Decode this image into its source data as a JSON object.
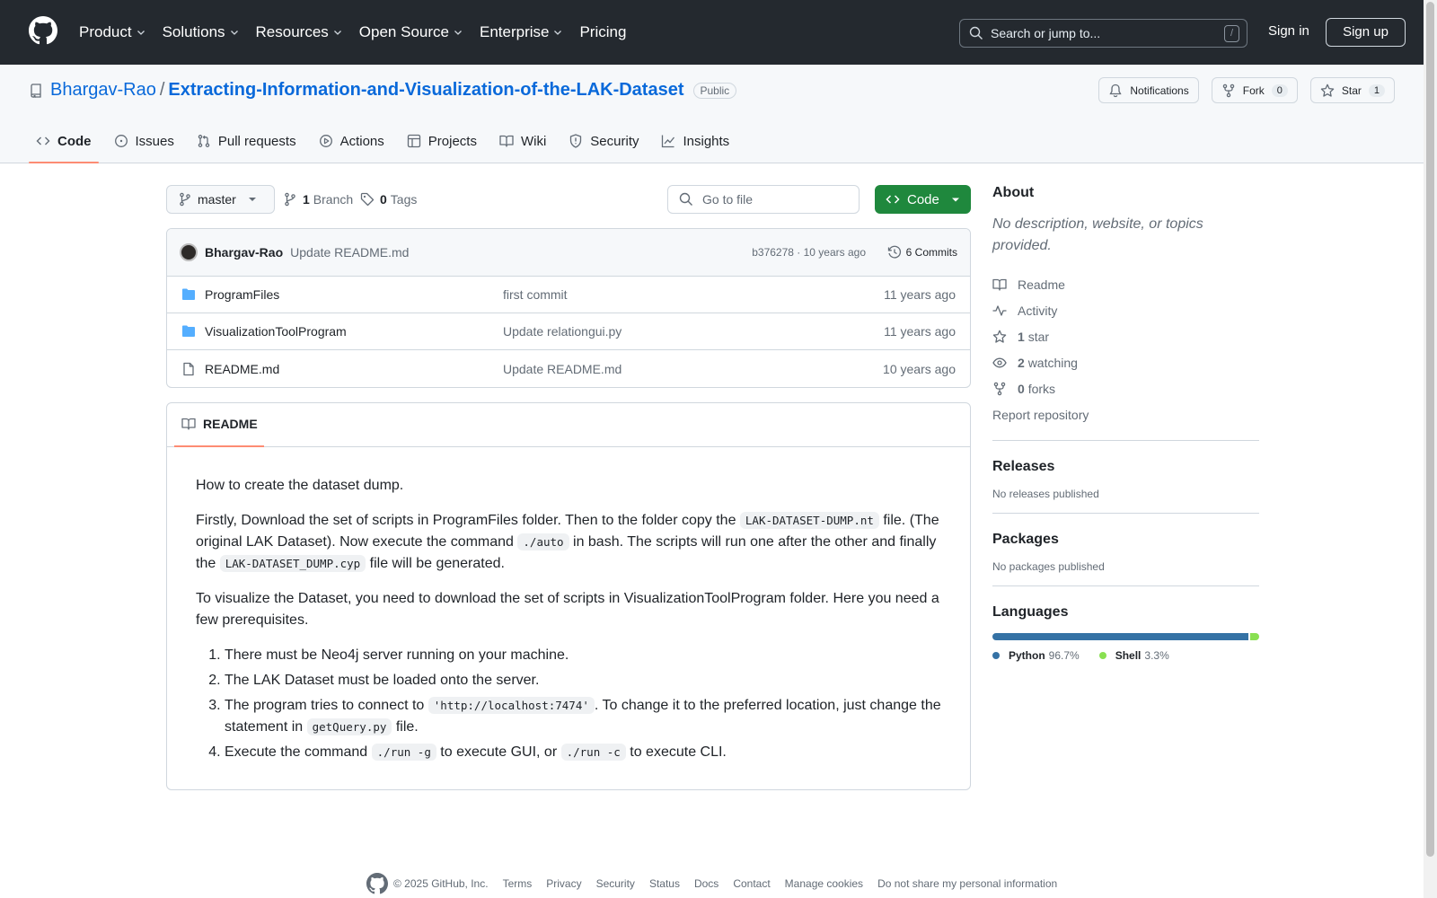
{
  "header": {
    "nav": [
      "Product",
      "Solutions",
      "Resources",
      "Open Source",
      "Enterprise",
      "Pricing"
    ],
    "search_placeholder": "Search or jump to...",
    "search_key": "/",
    "sign_in": "Sign in",
    "sign_up": "Sign up"
  },
  "repo": {
    "owner": "Bhargav-Rao",
    "separator": "/",
    "name": "Extracting-Information-and-Visualization-of-the-LAK-Dataset",
    "visibility": "Public",
    "notifications_label": "Notifications",
    "fork_label": "Fork",
    "fork_count": "0",
    "star_label": "Star",
    "star_count": "1",
    "tabs": [
      "Code",
      "Issues",
      "Pull requests",
      "Actions",
      "Projects",
      "Wiki",
      "Security",
      "Insights"
    ]
  },
  "toolbar": {
    "branch": "master",
    "branch_count": "1",
    "branch_label": "Branch",
    "tag_count": "0",
    "tag_label": "Tags",
    "go_to_file": "Go to file",
    "code_button": "Code"
  },
  "commit": {
    "author": "Bhargav-Rao",
    "message": "Update README.md",
    "hash_age": "b376278 · 10 years ago",
    "commits": "6 Commits"
  },
  "files": [
    {
      "name": "ProgramFiles",
      "type": "folder",
      "message": "first commit",
      "age": "11 years ago"
    },
    {
      "name": "VisualizationToolProgram",
      "type": "folder",
      "message": "Update relationgui.py",
      "age": "11 years ago"
    },
    {
      "name": "README.md",
      "type": "file",
      "message": "Update README.md",
      "age": "10 years ago"
    }
  ],
  "readme": {
    "tab": "README",
    "p1": "How to create the dataset dump.",
    "p2": {
      "a": "Firstly, Download the set of scripts in ProgramFiles folder. Then to the folder copy the ",
      "c1": "LAK-DATASET-DUMP.nt",
      "b": " file. (The original LAK Dataset). Now execute the command ",
      "c2": "./auto",
      "d": " in bash. The scripts will run one after the other and finally the ",
      "c3": "LAK-DATASET_DUMP.cyp",
      "e": " file will be generated."
    },
    "p3": "To visualize the Dataset, you need to download the set of scripts in VisualizationToolProgram folder. Here you need a few prerequisites.",
    "li1": "There must be Neo4j server running on your machine.",
    "li2": "The LAK Dataset must be loaded onto the server.",
    "li3": {
      "a": "The program tries to connect to ",
      "c1": "'http://localhost:7474'",
      "b": ". To change it to the preferred location, just change the statement in ",
      "c2": "getQuery.py",
      "d": " file."
    },
    "li4": {
      "a": "Execute the command ",
      "c1": "./run -g",
      "b": " to execute GUI, or ",
      "c2": "./run -c",
      "d": " to execute CLI."
    }
  },
  "about": {
    "title": "About",
    "description": "No description, website, or topics provided.",
    "readme": "Readme",
    "activity": "Activity",
    "stars_count": "1",
    "stars_label": "star",
    "watching_count": "2",
    "watching_label": "watching",
    "forks_count": "0",
    "forks_label": "forks",
    "report": "Report repository"
  },
  "releases": {
    "title": "Releases",
    "text": "No releases published"
  },
  "packages": {
    "title": "Packages",
    "text": "No packages published"
  },
  "languages": {
    "title": "Languages",
    "items": [
      {
        "name": "Python",
        "percent": "96.7%",
        "value": 96.7,
        "color": "#3572A5"
      },
      {
        "name": "Shell",
        "percent": "3.3%",
        "value": 3.3,
        "color": "#89e051"
      }
    ]
  },
  "footer": {
    "copyright": "© 2025 GitHub, Inc.",
    "links": [
      "Terms",
      "Privacy",
      "Security",
      "Status",
      "Docs",
      "Contact",
      "Manage cookies",
      "Do not share my personal information"
    ]
  },
  "icons": [
    "github-logo-icon",
    "chevron-down-icon",
    "search-icon",
    "repo-icon",
    "bell-icon",
    "fork-icon",
    "star-icon",
    "code-icon",
    "issue-icon",
    "pull-request-icon",
    "play-icon",
    "table-icon",
    "book-icon",
    "shield-icon",
    "graph-icon",
    "branch-icon",
    "tag-icon",
    "history-icon",
    "folder-icon",
    "file-icon",
    "pulse-icon",
    "eye-icon"
  ]
}
